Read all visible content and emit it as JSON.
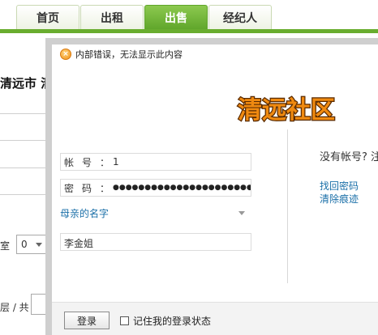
{
  "nav": {
    "tabs": [
      {
        "label": "首页",
        "active": false
      },
      {
        "label": "出租",
        "active": false
      },
      {
        "label": "出售",
        "active": true
      },
      {
        "label": "经纪人",
        "active": false
      }
    ],
    "accent_color": "#69ad2f"
  },
  "background_page": {
    "city_text": "清远市 清",
    "room_label": "室",
    "room_select_value": "0",
    "floor_label": "层 / 共"
  },
  "dialog": {
    "error_icon": "x-circle-icon",
    "error_text": "内部错误，无法显示此内容",
    "logo_text": "清远社区",
    "account_label": "帐号：",
    "account_value": "1",
    "password_label": "密码：",
    "password_value": "●●●●●●●●●●●●●●●●●●●●●●●●●●●●●●",
    "security_question": "母亲的名字",
    "security_answer": "李金姐",
    "no_account_text": "没有帐号? 注",
    "forgot_password_link": "找回密码",
    "clear_traces_link": "清除痕迹",
    "login_button": "登录",
    "remember_label": "记住我的登录状态"
  }
}
